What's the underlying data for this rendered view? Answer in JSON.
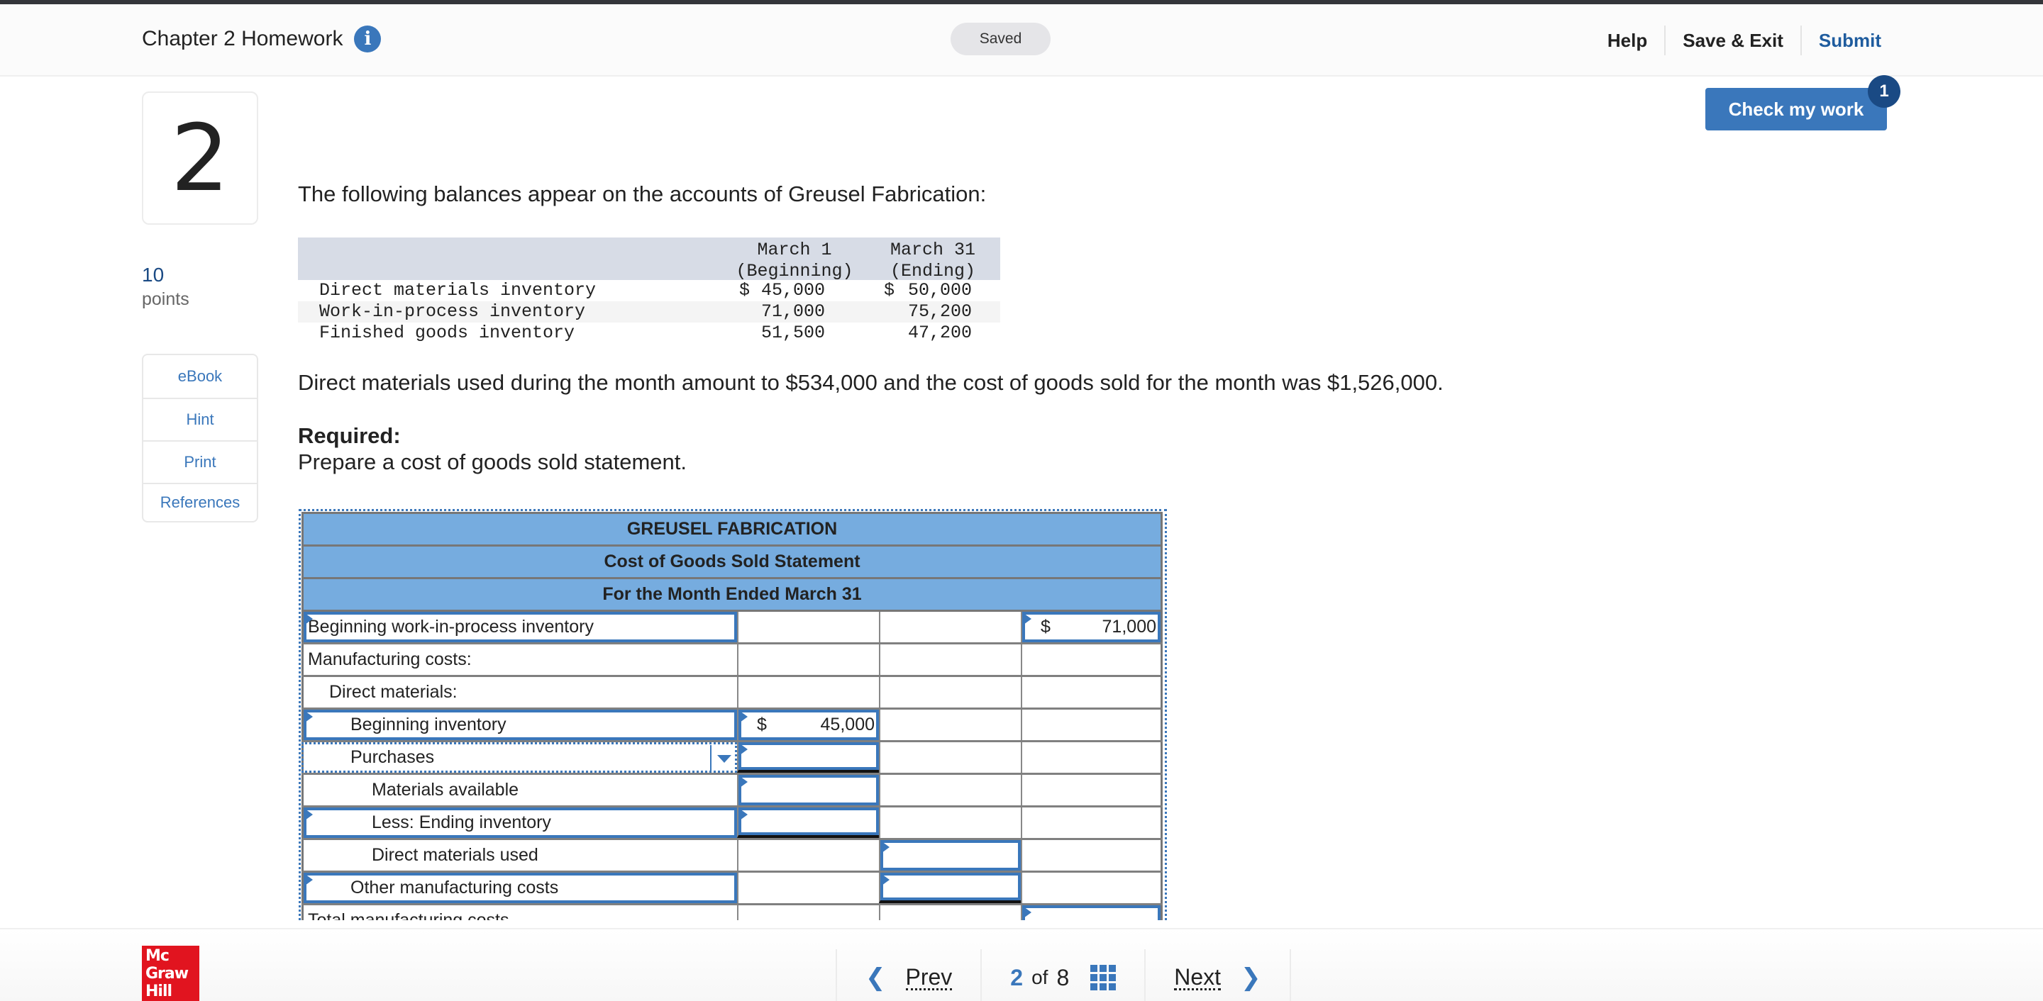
{
  "header": {
    "title": "Chapter 2 Homework",
    "info_icon": "info-icon",
    "status": "Saved",
    "links": {
      "help": "Help",
      "save_exit": "Save & Exit",
      "submit": "Submit"
    }
  },
  "check_work": {
    "label": "Check my work",
    "badge": "1"
  },
  "question": {
    "number": "2",
    "points_value": "10",
    "points_label": "points",
    "tools": [
      "eBook",
      "Hint",
      "Print",
      "References"
    ],
    "intro": "The following balances appear on the accounts of Greusel Fabrication:",
    "balances": {
      "headers": [
        {
          "line1": "March 1",
          "line2": "(Beginning)"
        },
        {
          "line1": "March 31",
          "line2": "(Ending)"
        }
      ],
      "rows": [
        {
          "label": "Direct materials inventory",
          "beginning": "45,000",
          "ending": "50,000",
          "currency": "$"
        },
        {
          "label": "Work-in-process inventory",
          "beginning": "71,000",
          "ending": "75,200",
          "currency": ""
        },
        {
          "label": "Finished goods inventory",
          "beginning": "51,500",
          "ending": "47,200",
          "currency": ""
        }
      ]
    },
    "paragraph": "Direct materials used during the month amount to $534,000 and the cost of goods sold for the month was $1,526,000.",
    "required_label": "Required:",
    "required_text": "Prepare a cost of goods sold statement."
  },
  "statement": {
    "company": "GREUSEL FABRICATION",
    "title": "Cost of Goods Sold Statement",
    "period": "For the Month Ended March 31",
    "rows": [
      {
        "label": "Beginning work-in-process inventory",
        "col2": "",
        "col3": "",
        "col4_currency": "$",
        "col4": "71,000"
      },
      {
        "label": "Manufacturing costs:",
        "col2": "",
        "col3": "",
        "col4": ""
      },
      {
        "label": "Direct materials:",
        "col2": "",
        "col3": "",
        "col4": ""
      },
      {
        "label": "Beginning inventory",
        "col2_currency": "$",
        "col2": "45,000",
        "col3": "",
        "col4": ""
      },
      {
        "label": "Purchases",
        "col2": "",
        "col3": "",
        "col4": ""
      },
      {
        "label": "Materials available",
        "col2": "",
        "col3": "",
        "col4": ""
      },
      {
        "label": "Less: Ending inventory",
        "col2": "",
        "col3": "",
        "col4": ""
      },
      {
        "label": "Direct materials used",
        "col2": "",
        "col3": "",
        "col4": ""
      },
      {
        "label": "Other manufacturing costs",
        "col2": "",
        "col3": "",
        "col4": ""
      },
      {
        "label": "Total manufacturing costs",
        "col2": "",
        "col3": "",
        "col4": ""
      }
    ]
  },
  "footer": {
    "logo_lines": [
      "Mc",
      "Graw",
      "Hill"
    ],
    "prev": "Prev",
    "current_page": "2",
    "of": "of",
    "total_pages": "8",
    "next": "Next"
  },
  "colors": {
    "accent": "#3a77bb",
    "accent_dark": "#1a4a84",
    "statement_header": "#76acdf",
    "brand_red": "#e1141f"
  }
}
